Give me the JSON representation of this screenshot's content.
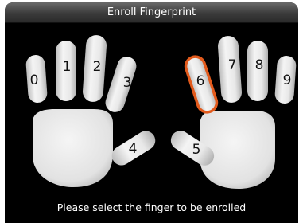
{
  "window": {
    "title": "Enroll Fingerprint"
  },
  "fingers": [
    {
      "label": "0",
      "selected": false
    },
    {
      "label": "1",
      "selected": false
    },
    {
      "label": "2",
      "selected": false
    },
    {
      "label": "3",
      "selected": false
    },
    {
      "label": "4",
      "selected": false
    },
    {
      "label": "5",
      "selected": false
    },
    {
      "label": "6",
      "selected": true
    },
    {
      "label": "7",
      "selected": false
    },
    {
      "label": "8",
      "selected": false
    },
    {
      "label": "9",
      "selected": false
    }
  ],
  "instruction": "Please select the finger to be enrolled",
  "colors": {
    "background": "#000000",
    "hand": "#e6e6e6",
    "selected_outline": "#e25a1c"
  }
}
